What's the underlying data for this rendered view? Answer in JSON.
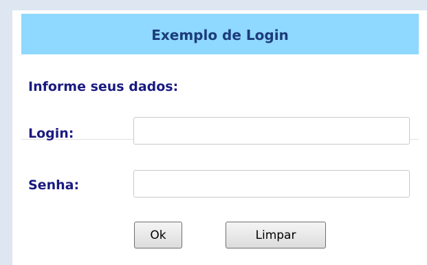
{
  "header": {
    "title": "Exemplo de Login"
  },
  "form": {
    "subtitle": "Informe seus dados:",
    "login_label": "Login:",
    "login_value": "",
    "senha_label": "Senha:",
    "senha_value": ""
  },
  "buttons": {
    "ok_label": "Ok",
    "limpar_label": "Limpar"
  },
  "colors": {
    "page_background": "#dde6f1",
    "header_background": "#8fd8ff",
    "header_text": "#1c3c7a",
    "label_text": "#1a1a80"
  }
}
